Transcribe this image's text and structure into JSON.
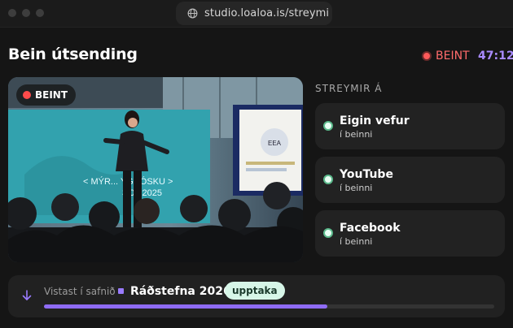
{
  "browser": {
    "url": "studio.loaloa.is/streymi"
  },
  "header": {
    "title": "Bein útsending",
    "live_label": "BEINT",
    "timer": "47:12"
  },
  "video": {
    "badge_label": "BEINT",
    "slide_text": "< MÝR... YGRÓSKU >",
    "slide_date": "3.09.2025",
    "screen_text": "EEA"
  },
  "destinations": {
    "heading": "STREYMIR Á",
    "items": [
      {
        "name": "Eigin vefur",
        "status": "í beinni"
      },
      {
        "name": "YouTube",
        "status": "í beinni"
      },
      {
        "name": "Facebook",
        "status": "í beinni"
      }
    ]
  },
  "recording": {
    "save_label": "Vistast í safnið",
    "file_name": "Ráðstefna 2026",
    "tag": "upptaka",
    "progress": 0.63
  },
  "colors": {
    "accent": "#8f6cf5",
    "live": "#ff5a5a",
    "status_ok": "#5bb98b",
    "tag_bg": "#d7f6e8"
  },
  "icons": {
    "address": "globe-icon",
    "save": "arrow-down-icon",
    "live": "record-dot-icon"
  }
}
